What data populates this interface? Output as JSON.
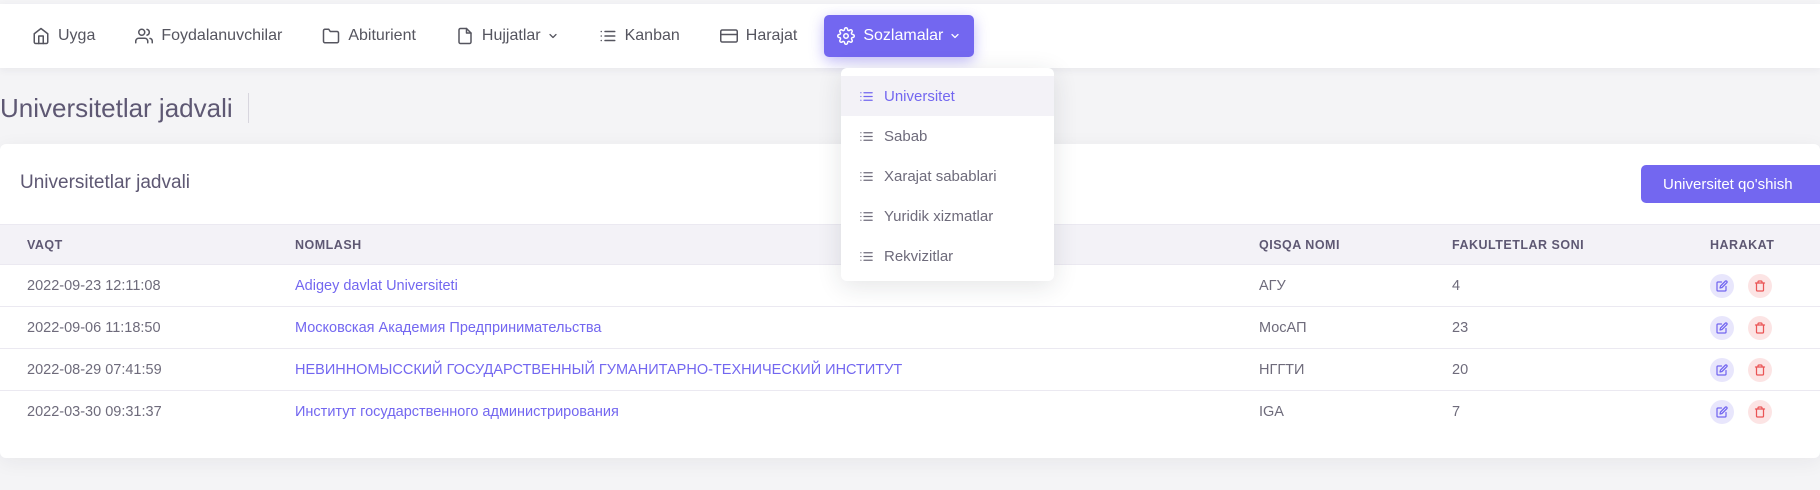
{
  "nav": {
    "items": [
      {
        "label": "Uyga",
        "icon": "home-icon"
      },
      {
        "label": "Foydalanuvchilar",
        "icon": "users-icon"
      },
      {
        "label": "Abiturient",
        "icon": "folder-icon"
      },
      {
        "label": "Hujjatlar",
        "icon": "file-icon"
      },
      {
        "label": "Kanban",
        "icon": "list-icon"
      },
      {
        "label": "Harajat",
        "icon": "credit-card-icon"
      },
      {
        "label": "Sozlamalar",
        "icon": "gear-icon"
      }
    ]
  },
  "settings_menu": {
    "items": [
      "Universitet",
      "Sabab",
      "Xarajat sabablari",
      "Yuridik xizmatlar",
      "Rekvizitlar"
    ],
    "active": "Universitet"
  },
  "page": {
    "title": "Universitetlar jadvali"
  },
  "card": {
    "title": "Universitetlar jadvali",
    "add_button": "Universitet qo'shish"
  },
  "table": {
    "headers": [
      "VAQT",
      "NOMLASH",
      "QISQA NOMI",
      "FAKULTETLAR SONI",
      "HARAKAT"
    ],
    "rows": [
      {
        "time": "2022-09-23 12:11:08",
        "name": "Adigey davlat Universiteti",
        "short": "АГУ",
        "faculties": "4"
      },
      {
        "time": "2022-09-06 11:18:50",
        "name": "Московская Академия Предпринимательства",
        "short": "МосАП",
        "faculties": "23"
      },
      {
        "time": "2022-08-29 07:41:59",
        "name": "НЕВИННОМЫССКИЙ ГОСУДАРСТВЕННЫЙ ГУМАНИТАРНО-ТЕХНИЧЕСКИЙ ИНСТИТУТ",
        "short": "НГГТИ",
        "faculties": "20"
      },
      {
        "time": "2022-03-30 09:31:37",
        "name": "Институт государственного администрирования",
        "short": "IGA",
        "faculties": "7"
      }
    ]
  },
  "colors": {
    "accent": "#7367f0",
    "danger": "#ea5455"
  }
}
